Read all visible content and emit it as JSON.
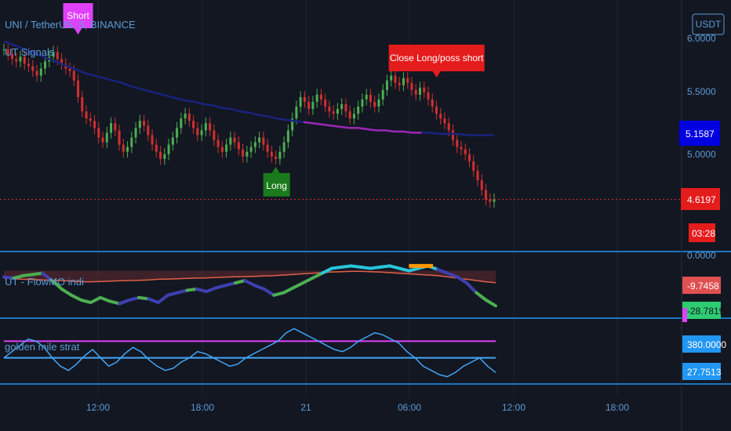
{
  "symbol_title": "UNI / TetherUS, 5, BINANCE",
  "currency_button": "USDT",
  "colors": {
    "background": "#131722",
    "up": "#4caf50",
    "down": "#d32f2f",
    "ema": "#1a237e",
    "ema_purple": "#9c27b0",
    "pane_border": "#2196f3",
    "axis_text": "#5b9bd5"
  },
  "chart_data": [
    {
      "type": "line",
      "title": "UT Signals",
      "x_ticks": [
        "12:00",
        "18:00",
        "21",
        "06:00",
        "12:00",
        "18:00"
      ],
      "y_ticks": [
        "6.0000",
        "5.5000",
        "5.0000"
      ],
      "price_close": [
        5.88,
        5.84,
        5.8,
        5.78,
        5.82,
        5.76,
        5.74,
        5.7,
        5.66,
        5.72,
        5.78,
        5.82,
        5.86,
        5.8,
        5.76,
        5.72,
        5.7,
        5.62,
        5.48,
        5.36,
        5.3,
        5.28,
        5.22,
        5.14,
        5.1,
        5.18,
        5.26,
        5.2,
        5.08,
        5.02,
        5.06,
        5.14,
        5.22,
        5.28,
        5.24,
        5.16,
        5.08,
        5.02,
        4.96,
        5.0,
        5.08,
        5.14,
        5.22,
        5.3,
        5.34,
        5.28,
        5.22,
        5.16,
        5.2,
        5.26,
        5.2,
        5.12,
        5.06,
        5.02,
        5.08,
        5.14,
        5.1,
        5.04,
        4.98,
        5.02,
        5.06,
        5.1,
        5.14,
        5.08,
        5.02,
        4.98,
        4.96,
        5.02,
        5.1,
        5.2,
        5.3,
        5.4,
        5.48,
        5.44,
        5.38,
        5.44,
        5.5,
        5.46,
        5.4,
        5.36,
        5.34,
        5.38,
        5.42,
        5.36,
        5.3,
        5.34,
        5.4,
        5.46,
        5.5,
        5.44,
        5.4,
        5.46,
        5.54,
        5.62,
        5.66,
        5.6,
        5.58,
        5.64,
        5.6,
        5.54,
        5.5,
        5.56,
        5.52,
        5.46,
        5.4,
        5.34,
        5.3,
        5.26,
        5.2,
        5.12,
        5.06,
        5.04,
        5.0,
        4.94,
        4.86,
        4.78,
        4.7,
        4.62,
        4.6,
        4.6197
      ],
      "ema": [
        5.95,
        5.92,
        5.89,
        5.86,
        5.83,
        5.8,
        5.77,
        5.74,
        5.71,
        5.68,
        5.66,
        5.64,
        5.62,
        5.6,
        5.57,
        5.55,
        5.53,
        5.51,
        5.49,
        5.47,
        5.45,
        5.44,
        5.42,
        5.41,
        5.39,
        5.38,
        5.36,
        5.35,
        5.33,
        5.32,
        5.3,
        5.29,
        5.28,
        5.27,
        5.26,
        5.25,
        5.24,
        5.23,
        5.22,
        5.22,
        5.21,
        5.2,
        5.2,
        5.19,
        5.19,
        5.18,
        5.18,
        5.18,
        5.17,
        5.17,
        5.17,
        5.16,
        5.16,
        5.16,
        5.1587
      ],
      "current_price": "5.1587",
      "last_price": "4.6197",
      "countdown": "03:28",
      "signals": [
        {
          "label": "Short",
          "type": "short",
          "index": 18
        },
        {
          "label": "Long",
          "type": "long",
          "index": 66
        },
        {
          "label": "Close Long/poss short",
          "type": "close",
          "index": 94
        }
      ]
    },
    {
      "type": "line",
      "title": "UT - FlowMO indi",
      "y_ticks": [
        "0.0000"
      ],
      "values_labels": [
        "-9.7458",
        "-28.7819"
      ],
      "flow": [
        -5,
        -6,
        -4,
        -3,
        -2,
        -8,
        -15,
        -20,
        -24,
        -26,
        -22,
        -25,
        -27,
        -24,
        -22,
        -23,
        -26,
        -20,
        -18,
        -16,
        -15,
        -17,
        -14,
        -12,
        -10,
        -8,
        -12,
        -15,
        -20,
        -18,
        -14,
        -10,
        -6,
        -2,
        2,
        3,
        4,
        3,
        2,
        3,
        4,
        2,
        0,
        2,
        4,
        1,
        -2,
        -5,
        -10,
        -18,
        -24,
        -28.78
      ],
      "mo": [
        -6,
        -6.5,
        -7,
        -7.2,
        -7.5,
        -7.8,
        -8,
        -8.5,
        -9,
        -9,
        -8.8,
        -8.5,
        -8.2,
        -8,
        -7.8,
        -7.5,
        -7,
        -6.8,
        -6.5,
        -6.2,
        -6,
        -5.8,
        -5.5,
        -5.2,
        -5,
        -4.8,
        -4.5,
        -4.2,
        -4,
        -3.5,
        -3,
        -2.5,
        -2,
        -1.5,
        -1,
        -0.8,
        -0.5,
        -0.5,
        -0.8,
        -1,
        -1.5,
        -2,
        -2.5,
        -3,
        -3.5,
        -4,
        -5,
        -6,
        -7,
        -8,
        -9,
        -9.7458
      ]
    },
    {
      "type": "line",
      "title": "golden mile strat",
      "y_ticks": [
        "380.0000",
        "27.7513"
      ],
      "osc": [
        300,
        330,
        360,
        390,
        380,
        350,
        300,
        260,
        240,
        270,
        310,
        340,
        300,
        260,
        280,
        320,
        350,
        330,
        290,
        260,
        240,
        250,
        280,
        300,
        330,
        320,
        300,
        280,
        260,
        270,
        300,
        320,
        340,
        360,
        380,
        420,
        440,
        420,
        400,
        380,
        360,
        340,
        330,
        350,
        380,
        400,
        420,
        410,
        390,
        370,
        330,
        300,
        260,
        240,
        220,
        210,
        230,
        260,
        280,
        300,
        260,
        230
      ]
    }
  ]
}
